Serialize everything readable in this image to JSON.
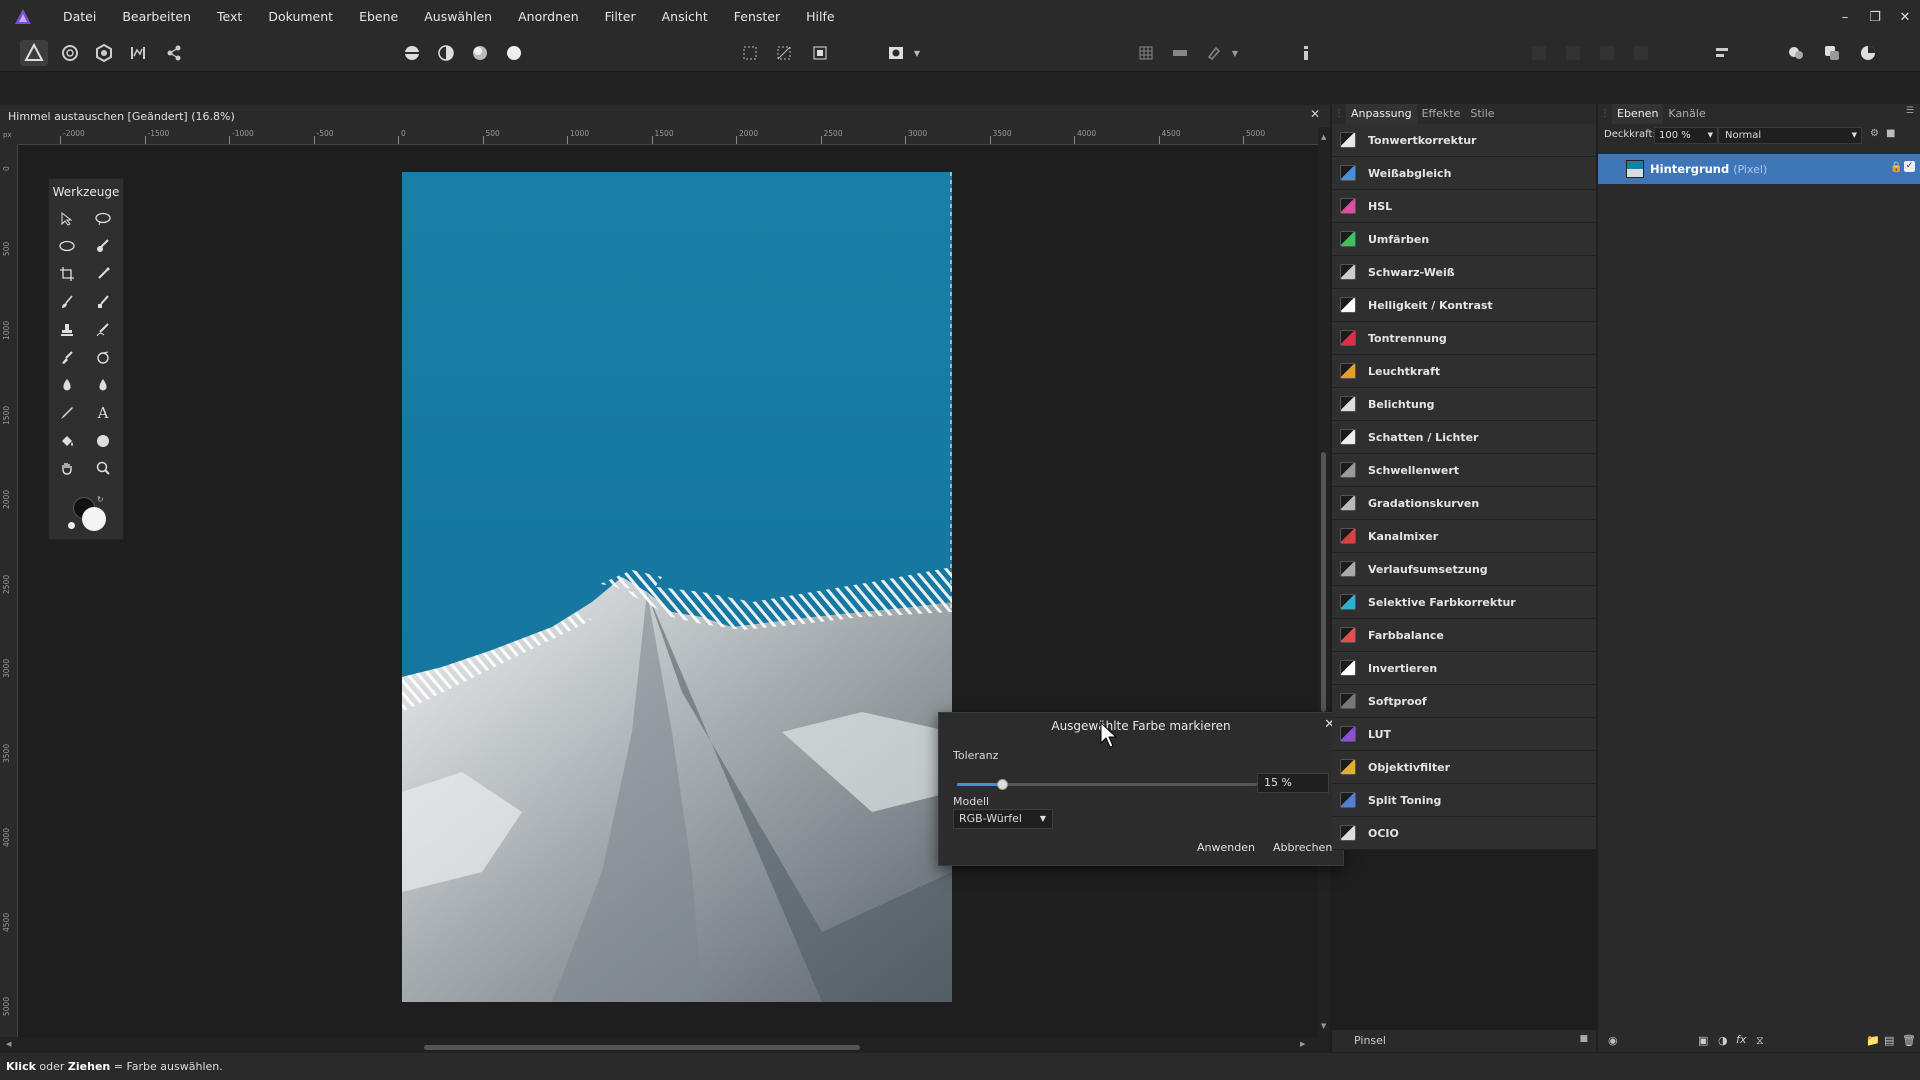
{
  "menu": [
    "Datei",
    "Bearbeiten",
    "Text",
    "Dokument",
    "Ebene",
    "Auswählen",
    "Anordnen",
    "Filter",
    "Ansicht",
    "Fenster",
    "Hilfe"
  ],
  "document": {
    "tab_title": "Himmel austauschen [Geändert] (16.8%)"
  },
  "rulers": {
    "top_ticks": [
      "-2000",
      "-1500",
      "-1000",
      "-500",
      "0",
      "500",
      "1000",
      "1500",
      "2000",
      "2500",
      "3000",
      "3500",
      "4000",
      "4500",
      "5000"
    ],
    "left_ticks": [
      "0",
      "500",
      "1000",
      "1500",
      "2000",
      "2500",
      "3000",
      "3500",
      "4000",
      "4500",
      "5000"
    ],
    "unit": "px"
  },
  "tools_panel": {
    "title": "Werkzeuge"
  },
  "dialog": {
    "title": "Ausgewählte Farbe markieren",
    "tolerance_label": "Toleranz",
    "tolerance_value": "15 %",
    "tolerance_fraction": 0.15,
    "model_label": "Modell",
    "model_value": "RGB-Würfel",
    "apply_label": "Anwenden",
    "cancel_label": "Abbrechen"
  },
  "adjustments_panel": {
    "tabs": [
      "Anpassung",
      "Effekte",
      "Stile"
    ],
    "items": [
      {
        "label": "Tonwertkorrektur",
        "color": "#e8e8e8"
      },
      {
        "label": "Weißabgleich",
        "color": "#4a90d9"
      },
      {
        "label": "HSL",
        "color": "#d94fa0"
      },
      {
        "label": "Umfärben",
        "color": "#3fbf5f"
      },
      {
        "label": "Schwarz-Weiß",
        "color": "#cccccc"
      },
      {
        "label": "Helligkeit / Kontrast",
        "color": "#ffffff"
      },
      {
        "label": "Tontrennung",
        "color": "#d9304a"
      },
      {
        "label": "Leuchtkraft",
        "color": "#e0a030"
      },
      {
        "label": "Belichtung",
        "color": "#dddddd"
      },
      {
        "label": "Schatten / Lichter",
        "color": "#eeeeee"
      },
      {
        "label": "Schwellenwert",
        "color": "#999999"
      },
      {
        "label": "Gradationskurven",
        "color": "#bbbbbb"
      },
      {
        "label": "Kanalmixer",
        "color": "#d94040"
      },
      {
        "label": "Verlaufsumsetzung",
        "color": "#aaaaaa"
      },
      {
        "label": "Selektive Farbkorrektur",
        "color": "#30b0d0"
      },
      {
        "label": "Farbbalance",
        "color": "#e05050"
      },
      {
        "label": "Invertieren",
        "color": "#ffffff"
      },
      {
        "label": "Softproof",
        "color": "#777777"
      },
      {
        "label": "LUT",
        "color": "#8a50d0"
      },
      {
        "label": "Objektivfilter",
        "color": "#e0b030"
      },
      {
        "label": "Split Toning",
        "color": "#5080d0"
      },
      {
        "label": "OCIO",
        "color": "#dddddd"
      }
    ],
    "bottom_label": "Pinsel"
  },
  "layers_panel": {
    "tabs": [
      "Ebenen",
      "Kanäle"
    ],
    "opacity_label": "Deckkraft:",
    "opacity_value": "100 %",
    "blend_mode": "Normal",
    "layer_name": "Hintergrund",
    "layer_type": "(Pixel)"
  },
  "status": {
    "part1": "Klick",
    "part2": " oder ",
    "part3": "Ziehen",
    "part4": " = Farbe auswählen."
  },
  "colors": {
    "accent": "#3f76b8",
    "sky": "#1b7aa3"
  }
}
